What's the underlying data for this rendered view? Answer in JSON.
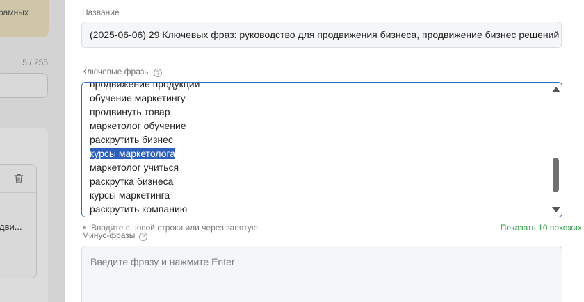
{
  "left_panel": {
    "banner_text": "рамных",
    "counter": "5 / 255",
    "card_text": "дви..."
  },
  "form": {
    "title_label": "Название",
    "title_value": "(2025-06-06) 29 Ключевых фраз: руководство для продвижения бизнеса, продвижение бизнес решений",
    "keywords_label": "Ключевые фразы",
    "keywords": [
      "продвижение продукции",
      "обучение маркетингу",
      "продвинуть товар",
      "маркетолог обучение",
      "раскрутить бизнес",
      "курсы маркетолога",
      "маркетолог учиться",
      "раскрутка бизнеса",
      "курсы маркетинга",
      "раскрутить компанию"
    ],
    "selected_keyword": "курсы маркетолога",
    "keywords_hint": "Вводите с новой строки или через запятую",
    "show_similar": "Показать 10 похожих",
    "minus_label": "Минус-фразы",
    "minus_placeholder": "Введите фразу и нажмите Enter"
  },
  "icons": {
    "help": "question-circle-icon",
    "trash": "trash-icon"
  },
  "colors": {
    "accent": "#2f6fbd",
    "selection": "#2b5fb9",
    "link_green": "#3a9a4a"
  }
}
